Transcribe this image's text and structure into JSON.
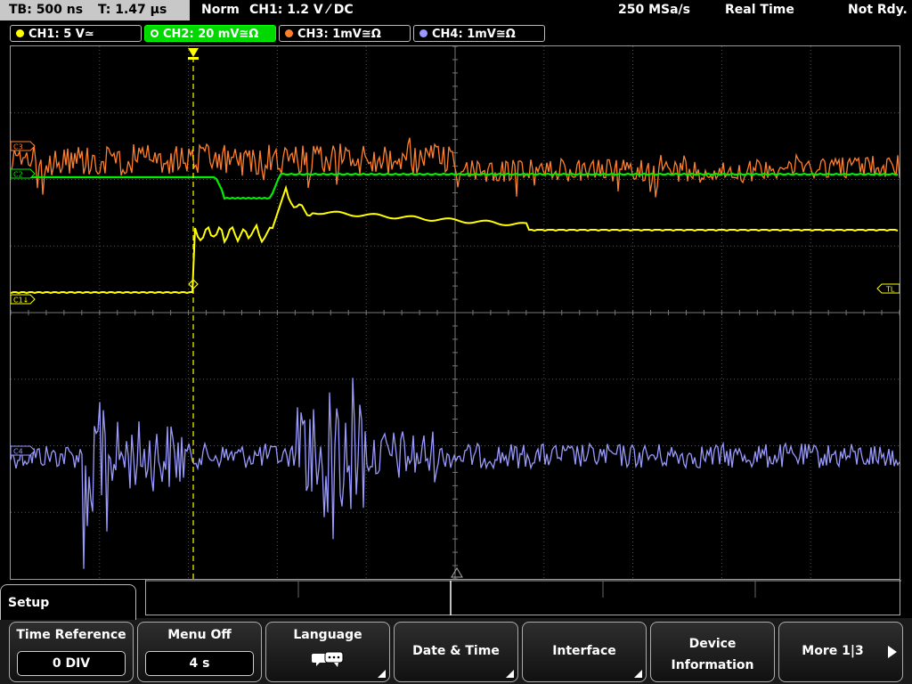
{
  "status": {
    "timebase": "TB: 500 ns",
    "trigger_time": "T: 1.47 µs",
    "mode": "Norm",
    "trigger_setting": "CH1: 1.2 V ⁄ DC",
    "sample_rate": "250 MSa/s",
    "acq_mode": "Real Time",
    "ready_state": "Not Rdy."
  },
  "channels": [
    {
      "label": "CH1: 5 V≃",
      "color": "#ffff00",
      "active": false
    },
    {
      "label": "CH2: 20 mV≅Ω",
      "color": "#00d800",
      "active": true
    },
    {
      "label": "CH3: 1mV≅Ω",
      "color": "#ff7f2a",
      "active": false
    },
    {
      "label": "CH4: 1mV≅Ω",
      "color": "#9999ff",
      "active": false
    }
  ],
  "markers": {
    "c3": "C3",
    "c2": "C2",
    "c1": "C1↓",
    "c4": "C4",
    "trigger_level": "TL"
  },
  "menu": {
    "title": "Setup",
    "keys": [
      {
        "label": "Time Reference",
        "value": "0 DIV"
      },
      {
        "label": "Menu Off",
        "value": "4 s"
      },
      {
        "label": "Language",
        "icon": "speech-bubbles-icon"
      },
      {
        "label": "Date & Time"
      },
      {
        "label": "Interface"
      },
      {
        "label": "Device",
        "label2": "Information"
      },
      {
        "label": "More 1|3"
      }
    ]
  }
}
